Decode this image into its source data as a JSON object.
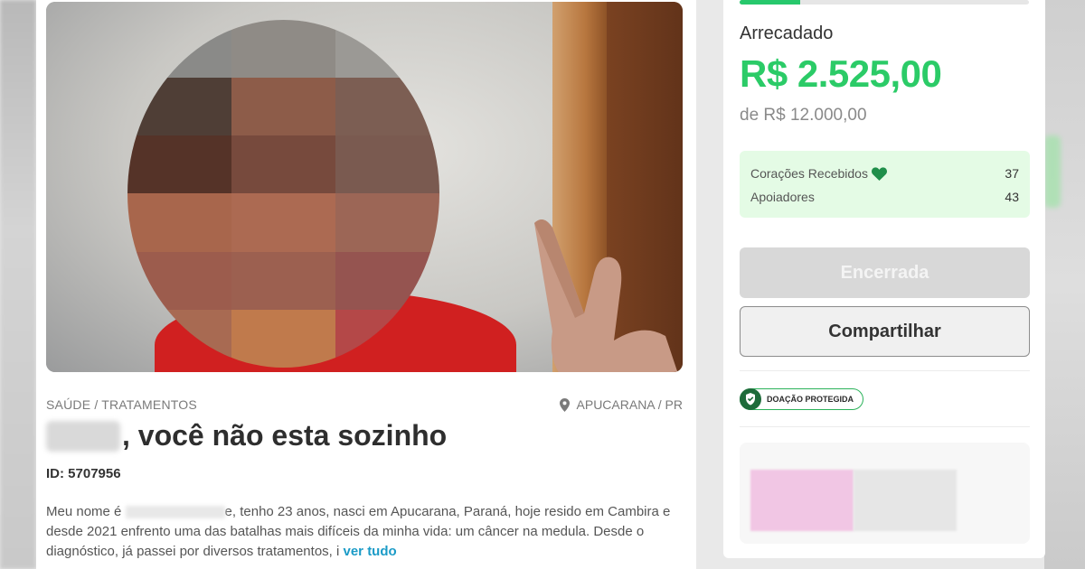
{
  "campaign": {
    "category": "SAÚDE / TRATAMENTOS",
    "location": "APUCARANA / PR",
    "title_suffix": ", você não esta sozinho",
    "id_label": "ID: 5707956",
    "description_start": "Meu nome é ",
    "description_rest": "e, tenho 23 anos, nasci em Apucarana, Paraná, hoje resido em Cambira e desde 2021 enfrento uma das batalhas mais difíceis da minha vida: um câncer na medula. Desde o diagnóstico, já passei por diversos tratamentos, i ",
    "read_more": "ver tudo"
  },
  "sidebar": {
    "progress_fraction": 0.21,
    "raised_label": "Arrecadado",
    "raised_amount": "R$ 2.525,00",
    "goal": "de R$ 12.000,00",
    "stats": {
      "hearts_label": "Corações Recebidos",
      "hearts_value": "37",
      "supporters_label": "Apoiadores",
      "supporters_value": "43"
    },
    "closed_button": "Encerrada",
    "share_button": "Compartilhar",
    "protected_badge": "DOAÇÃO PROTEGIDA"
  },
  "colors": {
    "accent_green": "#2bcb67",
    "link_blue": "#1b9bc7",
    "stats_bg": "#e4fbe5"
  },
  "icons": {
    "location": "map-pin-icon",
    "heart": "heart-icon",
    "shield": "shield-icon"
  }
}
